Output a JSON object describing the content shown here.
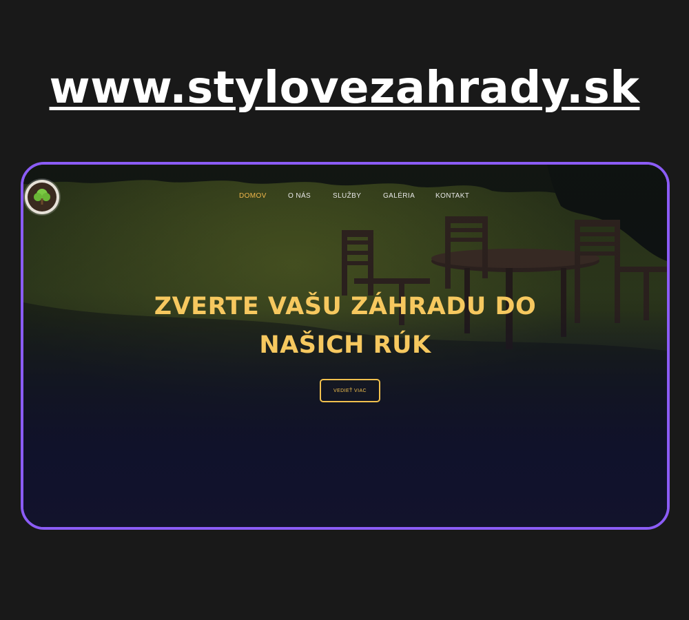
{
  "page": {
    "url_heading": "www.stylovezahrady.sk"
  },
  "colors": {
    "background": "#191919",
    "frame_border": "#8b5cf6",
    "accent_gold": "#f6c85f",
    "nav_active": "#f2b84b",
    "nav_text": "#e8e8e8"
  },
  "website": {
    "logo": {
      "icon": "tree-icon"
    },
    "nav": {
      "items": [
        {
          "label": "DOMOV",
          "active": true
        },
        {
          "label": "O NÁS",
          "active": false
        },
        {
          "label": "SLUŽBY",
          "active": false
        },
        {
          "label": "GALÉRIA",
          "active": false
        },
        {
          "label": "KONTAKT",
          "active": false
        }
      ]
    },
    "hero": {
      "title_line1": "ZVERTE VAŠU ZÁHRADU DO",
      "title_line2": "NAŠICH RÚK",
      "cta_label": "VEDIEŤ VIAC"
    }
  }
}
